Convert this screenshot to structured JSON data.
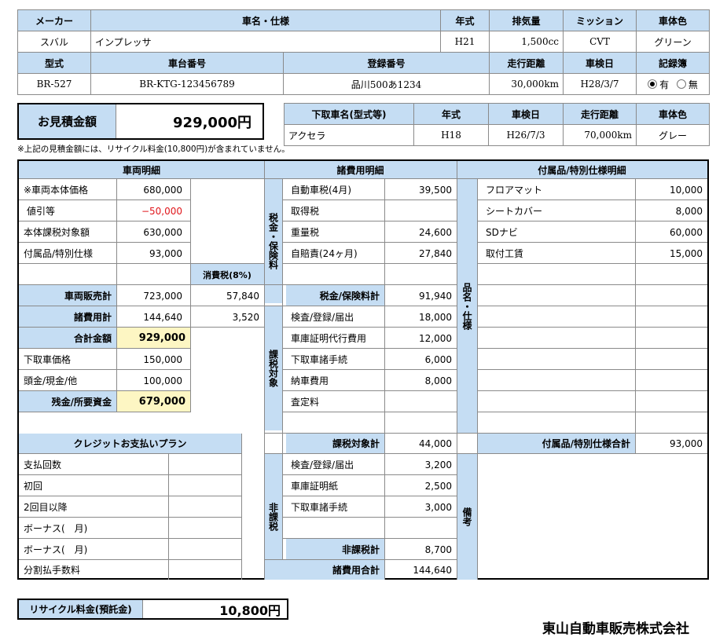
{
  "vehicle": {
    "headers": [
      "メーカー",
      "車名・仕様",
      "年式",
      "排気量",
      "ミッション",
      "車体色"
    ],
    "row": [
      "スバル",
      "インプレッサ",
      "H21",
      "1,500cc",
      "CVT",
      "グリーン"
    ],
    "headers2": [
      "型式",
      "車台番号",
      "登録番号",
      "走行距離",
      "車検日",
      "記録簿"
    ],
    "row2": [
      "BR-527",
      "BR-KTG-123456789",
      "品川500あ1234",
      "30,000km",
      "H28/3/7"
    ],
    "record_yes": "有",
    "record_no": "無"
  },
  "estimate": {
    "label": "お見積金額",
    "amount": "929,000円",
    "note": "※上記の見積金額には、リサイクル料金(10,800円)が含まれていません。"
  },
  "tradein": {
    "headers": [
      "下取車名(型式等)",
      "年式",
      "車検日",
      "走行距離",
      "車体色"
    ],
    "row": [
      "アクセラ",
      "H18",
      "H26/7/3",
      "70,000km",
      "グレー"
    ]
  },
  "vehicle_detail": {
    "title": "車両明細",
    "rows": [
      {
        "label": "※車両本体価格",
        "value": "680,000"
      },
      {
        "label": "値引等",
        "value": "−50,000"
      },
      {
        "label": "本体課税対象額",
        "value": "630,000"
      },
      {
        "label": "付属品/特別仕様",
        "value": "93,000"
      }
    ],
    "tax_label": "消費税(8%)",
    "sales_label": "車両販売計",
    "sales_value": "723,000",
    "sales_tax": "57,840",
    "fees_label": "諸費用計",
    "fees_value": "144,640",
    "fees_tax": "3,520",
    "total_label": "合計金額",
    "total_value": "929,000",
    "tradein_label": "下取車価格",
    "tradein_value": "150,000",
    "down_label": "頭金/現金/他",
    "down_value": "100,000",
    "balance_label": "残金/所要資金",
    "balance_value": "679,000"
  },
  "credit": {
    "title": "クレジットお支払いプラン",
    "rows": [
      "支払回数",
      "初回",
      "2回目以降",
      "ボーナス(　月)",
      "ボーナス(　月)",
      "分割払手数料"
    ]
  },
  "fees": {
    "title": "諸費用明細",
    "group1": "税金・保険料",
    "rows1": [
      {
        "label": "自動車税(4月)",
        "value": "39,500"
      },
      {
        "label": "取得税",
        "value": ""
      },
      {
        "label": "重量税",
        "value": "24,600"
      },
      {
        "label": "自賠責(24ヶ月)",
        "value": "27,840"
      }
    ],
    "subtotal1_label": "税金/保険料計",
    "subtotal1_value": "91,940",
    "group2": "課税対象",
    "rows2": [
      {
        "label": "検査/登録/届出",
        "value": "18,000"
      },
      {
        "label": "車庫証明代行費用",
        "value": "12,000"
      },
      {
        "label": "下取車諸手続",
        "value": "6,000"
      },
      {
        "label": "納車費用",
        "value": "8,000"
      },
      {
        "label": "査定料",
        "value": ""
      }
    ],
    "subtotal2_label": "課税対象計",
    "subtotal2_value": "44,000",
    "group3": "非課税",
    "rows3": [
      {
        "label": "検査/登録/届出",
        "value": "3,200"
      },
      {
        "label": "車庫証明紙",
        "value": "2,500"
      },
      {
        "label": "下取車諸手続",
        "value": "3,000"
      }
    ],
    "subtotal3_label": "非課税計",
    "subtotal3_value": "8,700",
    "total_label": "諸費用合計",
    "total_value": "144,640"
  },
  "options": {
    "title": "付属品/特別仕様明細",
    "side_label": "品名・仕様",
    "rows": [
      {
        "label": "フロアマット",
        "value": "10,000"
      },
      {
        "label": "シートカバー",
        "value": "8,000"
      },
      {
        "label": "SDナビ",
        "value": "60,000"
      },
      {
        "label": "取付工賃",
        "value": "15,000"
      }
    ],
    "total_label": "付属品/特別仕様合計",
    "total_value": "93,000",
    "remarks_label": "備考"
  },
  "recycle": {
    "label": "リサイクル料金(預託金)",
    "amount": "10,800円"
  },
  "footer_company": "東山自動車販売株式会社"
}
